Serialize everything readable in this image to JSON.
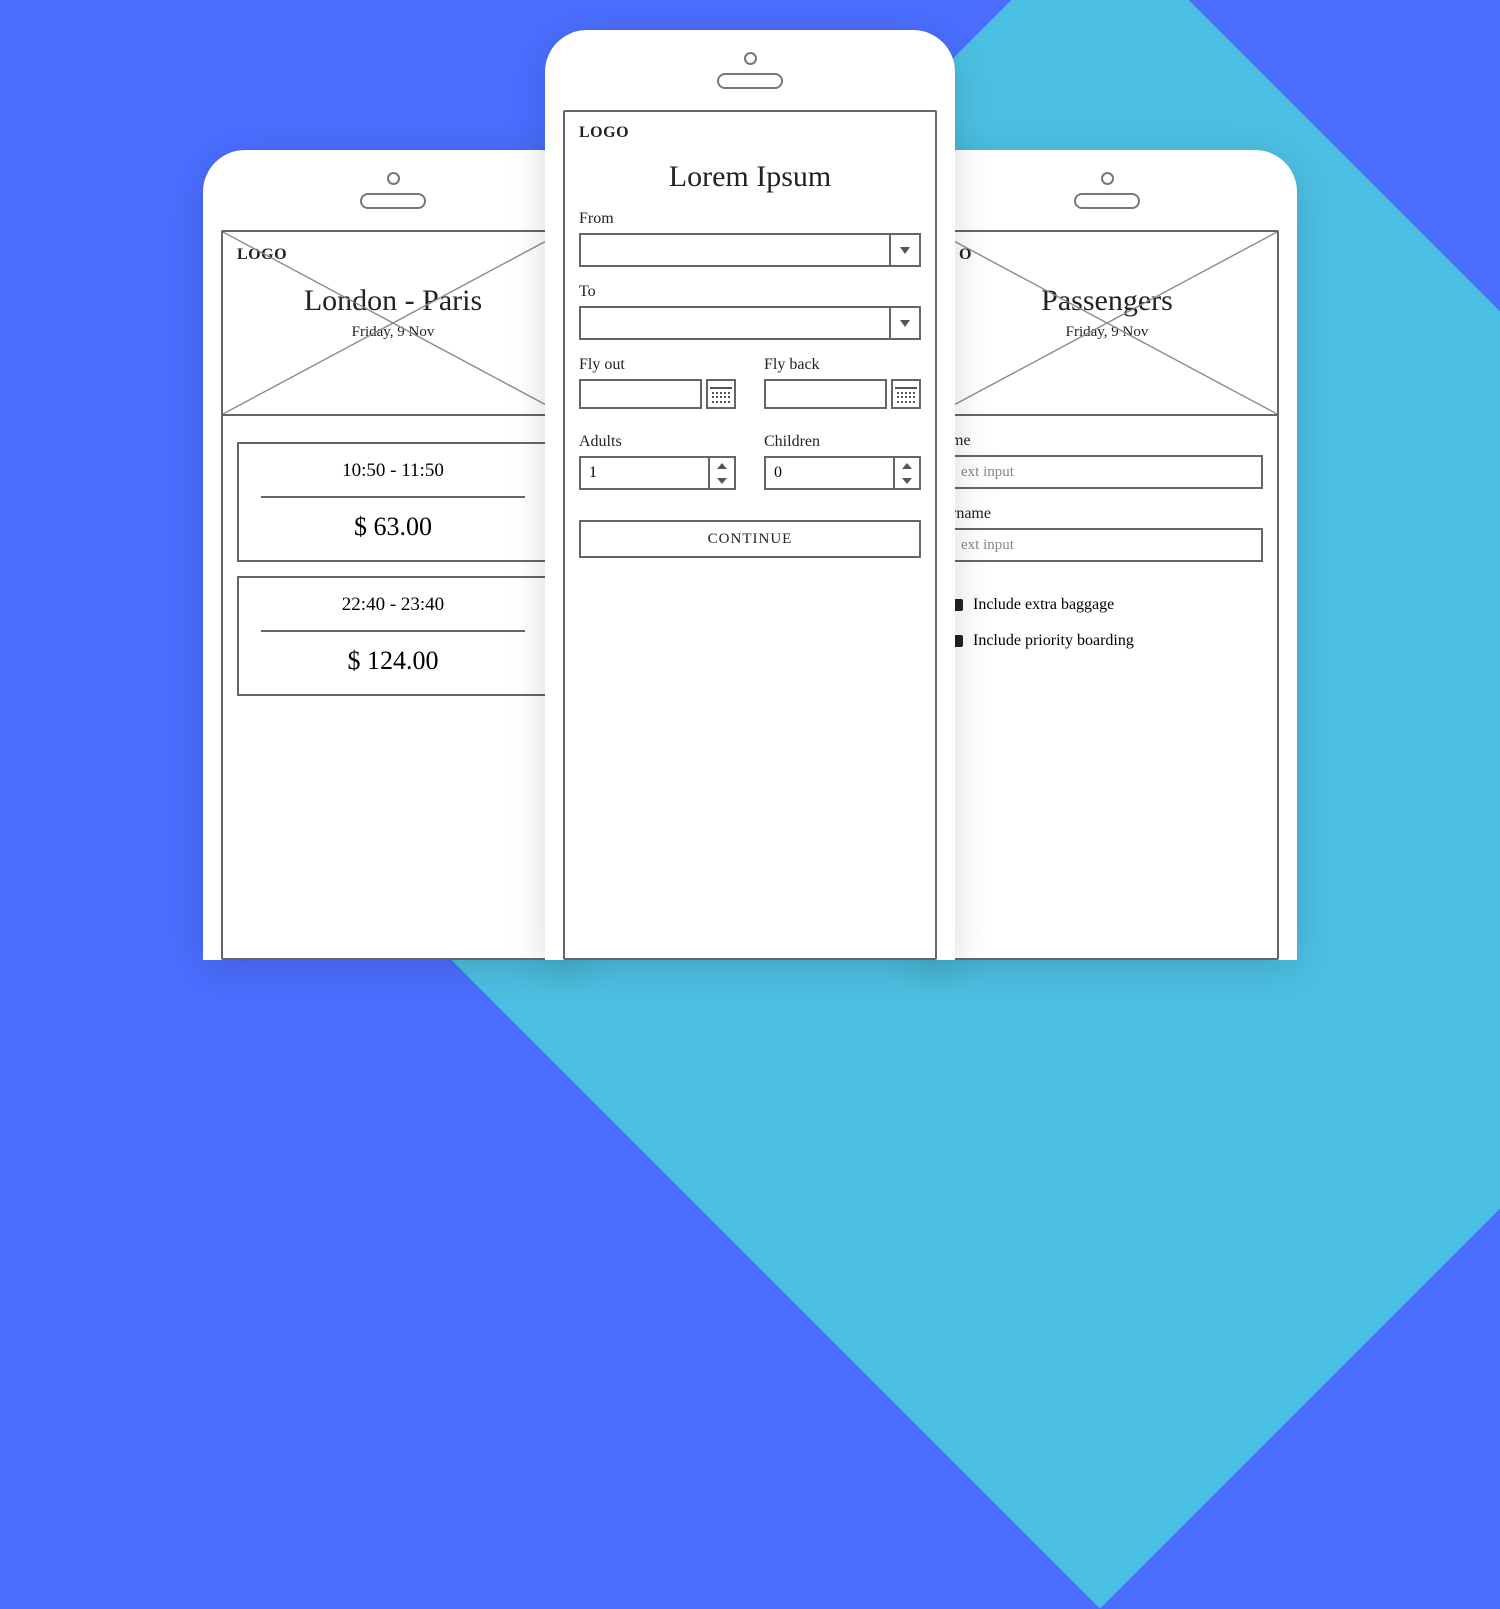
{
  "brand": {
    "logo_text": "LOGO"
  },
  "center": {
    "title": "Lorem Ipsum",
    "from_label": "From",
    "to_label": "To",
    "from_value": "",
    "to_value": "",
    "fly_out_label": "Fly out",
    "fly_back_label": "Fly back",
    "adults_label": "Adults",
    "children_label": "Children",
    "adults_value": "1",
    "children_value": "0",
    "continue_label": "CONTINUE"
  },
  "left": {
    "route_title": "London - Paris",
    "date_text": "Friday, 9 Nov",
    "results": [
      {
        "time": "10:50 - 11:50",
        "price": "$ 63.00"
      },
      {
        "time": "22:40 - 23:40",
        "price": "$ 124.00"
      }
    ]
  },
  "right": {
    "title": "Passengers",
    "date_text": "Friday, 9 Nov",
    "name_label": "me",
    "surname_label": "rname",
    "name_placeholder": "ext input",
    "surname_placeholder": "ext input",
    "extra_baggage_label": "Include extra baggage",
    "priority_label": "Include priority boarding"
  }
}
